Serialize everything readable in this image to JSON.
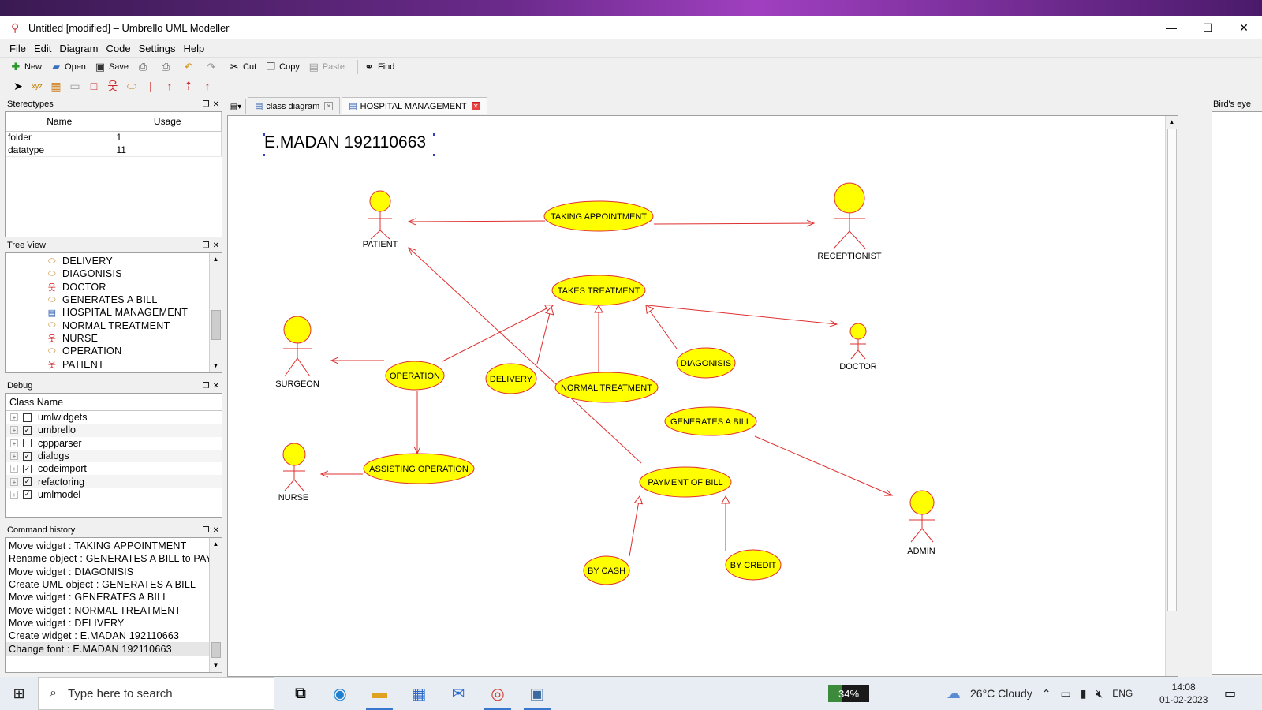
{
  "window": {
    "title": "Untitled [modified] – Umbrello UML Modeller",
    "controls": {
      "minimize": "—",
      "maximize": "☐",
      "close": "✕"
    }
  },
  "menu": [
    "File",
    "Edit",
    "Diagram",
    "Code",
    "Settings",
    "Help"
  ],
  "toolbar": {
    "new": "New",
    "open": "Open",
    "save": "Save",
    "cut": "Cut",
    "copy": "Copy",
    "paste": "Paste",
    "find": "Find"
  },
  "docks": {
    "stereotypes": {
      "title": "Stereotypes",
      "columns": [
        "Name",
        "Usage"
      ],
      "rows": [
        {
          "name": "folder",
          "usage": "1"
        },
        {
          "name": "datatype",
          "usage": "11"
        }
      ]
    },
    "tree_view": {
      "title": "Tree View",
      "items": [
        {
          "label": "DELIVERY",
          "icon": "usecase-icon"
        },
        {
          "label": "DIAGONISIS",
          "icon": "usecase-icon"
        },
        {
          "label": "DOCTOR",
          "icon": "actor-icon"
        },
        {
          "label": "GENERATES A BILL",
          "icon": "usecase-icon"
        },
        {
          "label": "HOSPITAL MANAGEMENT",
          "icon": "diagram-icon"
        },
        {
          "label": "NORMAL TREATMENT",
          "icon": "usecase-icon"
        },
        {
          "label": "NURSE",
          "icon": "actor-icon"
        },
        {
          "label": "OPERATION",
          "icon": "usecase-icon"
        },
        {
          "label": "PATIENT",
          "icon": "actor-icon"
        }
      ]
    },
    "debug": {
      "title": "Debug",
      "column": "Class Name",
      "items": [
        {
          "label": "umlwidgets",
          "checked": false
        },
        {
          "label": "umbrello",
          "checked": true
        },
        {
          "label": "cppparser",
          "checked": false
        },
        {
          "label": "dialogs",
          "checked": true
        },
        {
          "label": "codeimport",
          "checked": true
        },
        {
          "label": "refactoring",
          "checked": true
        },
        {
          "label": "umlmodel",
          "checked": true
        }
      ]
    },
    "command_history": {
      "title": "Command history",
      "items": [
        "Move widget : TAKING APPOINTMENT",
        "Rename object : GENERATES A BILL to PAYM",
        "Move widget : DIAGONISIS",
        "Create UML object : GENERATES A BILL",
        "Move widget : GENERATES A BILL",
        "Move widget : NORMAL TREATMENT",
        "Move widget : DELIVERY",
        "Create widget : E.MADAN 192110663",
        "Change font : E.MADAN 192110663"
      ]
    },
    "birds_eye": {
      "title": "Bird's eye"
    }
  },
  "tabs": [
    {
      "label": "class diagram",
      "active": false
    },
    {
      "label": "HOSPITAL MANAGEMENT",
      "active": true
    }
  ],
  "diagram": {
    "note": "E.MADAN 192110663",
    "colors": {
      "usecase_fill": "#ffff00",
      "line": "#e03030",
      "actor_fill": "#ffff00"
    },
    "actors": [
      "PATIENT",
      "RECEPTIONIST",
      "SURGEON",
      "DOCTOR",
      "NURSE",
      "ADMIN"
    ],
    "use_cases": [
      "TAKING APPOINTMENT",
      "TAKES TREATMENT",
      "OPERATION",
      "DELIVERY",
      "NORMAL TREATMENT",
      "DIAGONISIS",
      "GENERATES A BILL",
      "ASSISTING OPERATION",
      "PAYMENT OF BILL",
      "BY CASH",
      "BY CREDIT"
    ]
  },
  "taskbar": {
    "search_placeholder": "Type here to search",
    "battery": "34%",
    "weather": "26°C  Cloudy",
    "language": "ENG",
    "time": "14:08",
    "date": "01-02-2023"
  }
}
